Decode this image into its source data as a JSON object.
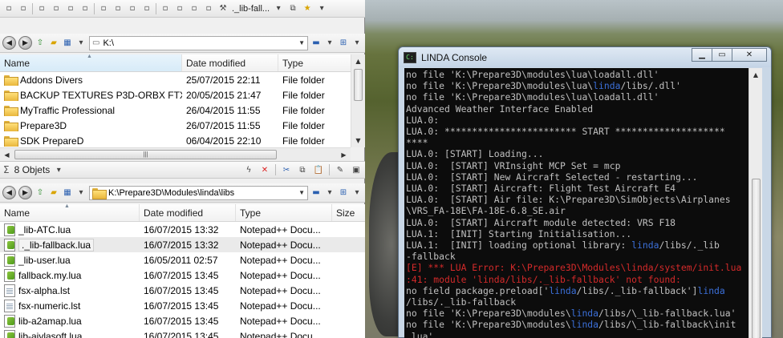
{
  "top_toolbar": {
    "breadcrumb": "._lib-fall..."
  },
  "pane_top": {
    "address": "K:\\",
    "columns": [
      "Name",
      "Date modified",
      "Type"
    ],
    "rows": [
      {
        "name": "Addons Divers",
        "date": "25/07/2015 22:11",
        "type": "File folder"
      },
      {
        "name": "BACKUP TEXTURES P3D-ORBX FTX G",
        "date": "20/05/2015 21:47",
        "type": "File folder"
      },
      {
        "name": "MyTraffic Professional",
        "date": "26/04/2015 11:55",
        "type": "File folder"
      },
      {
        "name": "Prepare3D",
        "date": "26/07/2015 11:55",
        "type": "File folder"
      },
      {
        "name": "SDK PrepareD",
        "date": "06/04/2015 22:10",
        "type": "File folder"
      }
    ]
  },
  "status": {
    "count": "8 Objets"
  },
  "pane_bottom": {
    "address": "K:\\Prepare3D\\Modules\\linda\\libs",
    "columns": [
      "Name",
      "Date modified",
      "Type",
      "Size"
    ],
    "rows": [
      {
        "name": "_lib-ATC.lua",
        "date": "16/07/2015 13:32",
        "type": "Notepad++ Docu...",
        "icon": "npp"
      },
      {
        "name": "._lib-fallback.lua",
        "date": "16/07/2015 13:32",
        "type": "Notepad++ Docu...",
        "icon": "npp"
      },
      {
        "name": "_lib-user.lua",
        "date": "16/05/2011 02:57",
        "type": "Notepad++ Docu...",
        "icon": "npp"
      },
      {
        "name": "fallback.my.lua",
        "date": "16/07/2015 13:45",
        "type": "Notepad++ Docu...",
        "icon": "npp"
      },
      {
        "name": "fsx-alpha.lst",
        "date": "16/07/2015 13:45",
        "type": "Notepad++ Docu...",
        "icon": "lst"
      },
      {
        "name": "fsx-numeric.lst",
        "date": "16/07/2015 13:45",
        "type": "Notepad++ Docu...",
        "icon": "lst"
      },
      {
        "name": "lib-a2amap.lua",
        "date": "16/07/2015 13:45",
        "type": "Notepad++ Docu...",
        "icon": "npp"
      },
      {
        "name": "lib-aivlasoft.lua",
        "date": "16/07/2015 13:45",
        "type": "Notepad++ Docu...",
        "icon": "npp"
      }
    ]
  },
  "console": {
    "title": "LINDA Console",
    "lines": [
      {
        "text": "no file 'K:\\Prepare3D\\modules\\lua\\loadall.dll'",
        "color": "normal"
      },
      {
        "text": "no file 'K:\\Prepare3D\\modules\\lua\\linda/libs/.dll'",
        "color": "normal"
      },
      {
        "text": "no file 'K:\\Prepare3D\\modules\\lua\\loadall.dll'",
        "color": "normal"
      },
      {
        "text": "Advanced Weather Interface Enabled",
        "color": "normal"
      },
      {
        "text": "LUA.0:",
        "color": "normal"
      },
      {
        "text": "LUA.0: ************************ START ********************",
        "color": "normal"
      },
      {
        "text": "****",
        "color": "normal"
      },
      {
        "text": "LUA.0: [START] Loading...",
        "color": "normal"
      },
      {
        "text": "LUA.0:  [START] VRInsight MCP Set = mcp",
        "color": "normal"
      },
      {
        "text": "LUA.0:  [START] New Aircraft Selected - restarting...",
        "color": "normal"
      },
      {
        "text": "LUA.0:  [START] Aircraft: Flight Test Aircraft E4",
        "color": "normal"
      },
      {
        "text": "LUA.0:  [START] Air file: K:\\Prepare3D\\SimObjects\\Airplanes",
        "color": "normal"
      },
      {
        "text": "\\VRS_FA-18E\\FA-18E-6.8_SE.air",
        "color": "normal"
      },
      {
        "text": "LUA.0:  [START] Aircraft module detected: VRS F18",
        "color": "normal"
      },
      {
        "text": "LUA.1:  [INIT] Starting Initialisation...",
        "color": "normal"
      },
      {
        "text": "LUA.1:  [INIT] loading optional library: linda/libs/._lib",
        "color": "normal"
      },
      {
        "text": "-fallback",
        "color": "normal"
      },
      {
        "text": "[E] *** LUA Error: K:\\Prepare3D\\Modules\\linda/system/init.lua",
        "color": "red"
      },
      {
        "text": ":41: module 'linda/libs/._lib-fallback' not found:",
        "color": "red"
      },
      {
        "text": "no field package.preload['linda/libs/._lib-fallback']linda",
        "color": "normal"
      },
      {
        "text": "/libs/._lib-fallback",
        "color": "normal"
      },
      {
        "text": "no file 'K:\\Prepare3D\\modules\\linda/libs/\\_lib-fallback.lua'",
        "color": "normal"
      },
      {
        "text": "no file 'K:\\Prepare3D\\modules\\linda/libs/\\_lib-fallback\\init",
        "color": "normal"
      },
      {
        "text": ".lua'",
        "color": "normal"
      }
    ]
  },
  "colors": {
    "console_bg": "#0c0c0c",
    "console_text": "#c0c0c0",
    "console_error": "#d42a2a",
    "console_path_highlight": "#3b6fd8"
  }
}
